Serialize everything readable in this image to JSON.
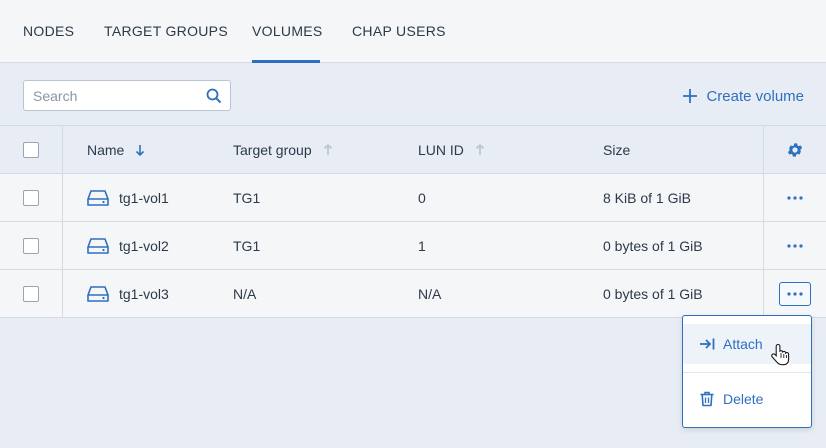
{
  "tabs": [
    {
      "label": "NODES"
    },
    {
      "label": "TARGET GROUPS"
    },
    {
      "label": "VOLUMES",
      "active": true
    },
    {
      "label": "CHAP USERS"
    }
  ],
  "toolbar": {
    "search_placeholder": "Search",
    "create_label": "Create volume"
  },
  "table": {
    "columns": {
      "name": "Name",
      "target_group": "Target group",
      "lun_id": "LUN ID",
      "size": "Size"
    },
    "rows": [
      {
        "name": "tg1-vol1",
        "target_group": "TG1",
        "lun_id": "0",
        "size": "8 KiB of 1 GiB"
      },
      {
        "name": "tg1-vol2",
        "target_group": "TG1",
        "lun_id": "1",
        "size": "0 bytes of 1 GiB"
      },
      {
        "name": "tg1-vol3",
        "target_group": "N/A",
        "lun_id": "N/A",
        "size": "0 bytes of 1 GiB"
      }
    ]
  },
  "context_menu": {
    "attach_label": "Attach",
    "delete_label": "Delete"
  },
  "colors": {
    "accent": "#2f6fbf",
    "background": "#e8edf5",
    "row_background": "#f5f6f8"
  }
}
